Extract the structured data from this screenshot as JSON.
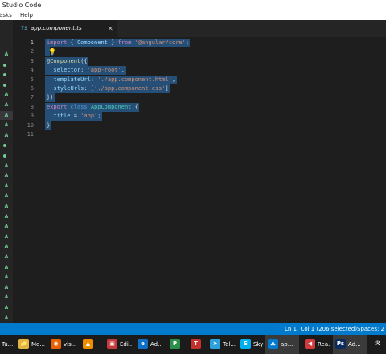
{
  "window": {
    "title": "l Studio Code"
  },
  "menubar": {
    "items": [
      "Tasks",
      "Help"
    ]
  },
  "tab": {
    "icon": "TS",
    "label": "app.component.ts",
    "close": "✕"
  },
  "gutter": {
    "line_numbers": [
      "1",
      "2",
      "3",
      "4",
      "5",
      "6",
      "7",
      "8",
      "9",
      "10",
      "11"
    ]
  },
  "git_status": {
    "badge_letter": "A",
    "rows": [
      {
        "kind": "badge",
        "selected": false
      },
      {
        "kind": "dot",
        "selected": false
      },
      {
        "kind": "dot",
        "selected": false
      },
      {
        "kind": "dot",
        "selected": false
      },
      {
        "kind": "badge",
        "selected": false
      },
      {
        "kind": "badge",
        "selected": false
      },
      {
        "kind": "badge",
        "selected": true
      },
      {
        "kind": "badge",
        "selected": false
      },
      {
        "kind": "badge",
        "selected": false
      },
      {
        "kind": "dot",
        "selected": false
      },
      {
        "kind": "dot",
        "selected": false
      },
      {
        "kind": "badge",
        "selected": false
      },
      {
        "kind": "badge",
        "selected": false
      },
      {
        "kind": "badge",
        "selected": false
      },
      {
        "kind": "badge",
        "selected": false
      },
      {
        "kind": "badge",
        "selected": false
      },
      {
        "kind": "badge",
        "selected": false
      },
      {
        "kind": "badge",
        "selected": false
      },
      {
        "kind": "badge",
        "selected": false
      },
      {
        "kind": "badge",
        "selected": false
      },
      {
        "kind": "badge",
        "selected": false
      },
      {
        "kind": "badge",
        "selected": false
      },
      {
        "kind": "badge",
        "selected": false
      },
      {
        "kind": "badge",
        "selected": false
      },
      {
        "kind": "badge",
        "selected": false
      },
      {
        "kind": "badge",
        "selected": false
      },
      {
        "kind": "badge",
        "selected": false
      }
    ]
  },
  "code": {
    "lines": [
      [
        [
          "kw",
          "import"
        ],
        [
          "pun",
          " { "
        ],
        [
          "id",
          "Component"
        ],
        [
          "pun",
          " } "
        ],
        [
          "kw",
          "from"
        ],
        [
          "pun",
          " "
        ],
        [
          "str",
          "'@angular/core'"
        ],
        [
          "pun",
          ";"
        ]
      ],
      [],
      [
        [
          "pun",
          "@"
        ],
        [
          "dec",
          "Component"
        ],
        [
          "pun",
          "({"
        ]
      ],
      [
        [
          "pun",
          "  "
        ],
        [
          "id",
          "selector"
        ],
        [
          "pun",
          ": "
        ],
        [
          "str",
          "'app-root'"
        ],
        [
          "pun",
          ","
        ]
      ],
      [
        [
          "pun",
          "  "
        ],
        [
          "id",
          "templateUrl"
        ],
        [
          "pun",
          ": "
        ],
        [
          "str",
          "'./app.component.html'"
        ],
        [
          "pun",
          ","
        ]
      ],
      [
        [
          "pun",
          "  "
        ],
        [
          "id",
          "styleUrls"
        ],
        [
          "pun",
          ": ["
        ],
        [
          "str",
          "'./app.component.css'"
        ],
        [
          "pun",
          "]"
        ]
      ],
      [
        [
          "pun",
          "})"
        ]
      ],
      [
        [
          "kw",
          "export"
        ],
        [
          "pun",
          " "
        ],
        [
          "kw2",
          "class"
        ],
        [
          "pun",
          " "
        ],
        [
          "cls",
          "AppComponent"
        ],
        [
          "pun",
          " {"
        ]
      ],
      [
        [
          "pun",
          "  "
        ],
        [
          "id",
          "title"
        ],
        [
          "pun",
          " = "
        ],
        [
          "str",
          "'app'"
        ],
        [
          "pun",
          ";"
        ]
      ],
      [
        [
          "pun",
          "}"
        ]
      ],
      []
    ],
    "lightbulb_icon": "💡"
  },
  "statusbar": {
    "position": "Ln 1, Col 1 (206 selected)",
    "spaces": "Spaces: 2"
  },
  "taskbar": {
    "items": [
      {
        "icon": "",
        "label": "Tu...",
        "color": "#1b1b1b"
      },
      {
        "icon": "📁",
        "label": "Me...",
        "color": "#e0b441"
      },
      {
        "icon": "◉",
        "label": "vis...",
        "color": "#e66000"
      },
      {
        "icon": "▲",
        "label": "",
        "color": "#f08c00"
      },
      {
        "icon": "▣",
        "label": "Edi...",
        "color": "#c43a3a"
      },
      {
        "icon": "e",
        "label": "Ad...",
        "color": "#0f6fc6"
      },
      {
        "icon": "P",
        "label": "",
        "color": "#2b8f4a"
      },
      {
        "icon": "T",
        "label": "",
        "color": "#c4302b"
      },
      {
        "icon": "➤",
        "label": "Tel...",
        "color": "#2aa1da"
      },
      {
        "icon": "S",
        "label": "Sky",
        "color": "#00aff0"
      },
      {
        "icon": "⟁",
        "label": "ap...",
        "color": "#007acc"
      },
      {
        "icon": "◀",
        "label": "Rea...",
        "color": "#d23b3b"
      },
      {
        "icon": "Ps",
        "label": "Ad...",
        "color": "#0c2b5e"
      },
      {
        "icon": "ℛ",
        "label": "",
        "color": "#1b1b1b"
      }
    ]
  }
}
